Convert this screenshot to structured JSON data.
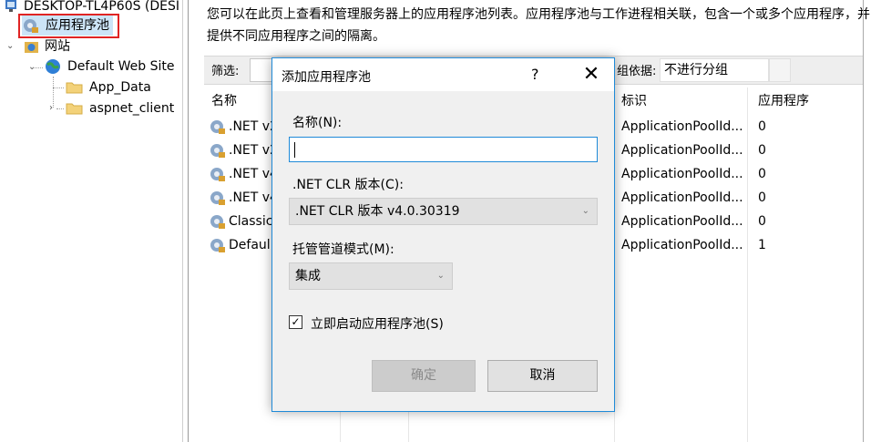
{
  "tree": {
    "server": "DESKTOP-TL4P60S (DESI",
    "app_pools": "应用程序池",
    "sites": "网站",
    "default_site": "Default Web Site",
    "app_data": "App_Data",
    "aspnet_client": "aspnet_client"
  },
  "main": {
    "description": "您可以在此页上查看和管理服务器上的应用程序池列表。应用程序池与工作进程相关联，包含一个或多个应用程序，并提供不同应用程序之间的隔离。",
    "filter_label": "筛选:",
    "group_label": "组依据:",
    "group_value": "不进行分组",
    "columns": [
      "名称",
      "标识",
      "应用程序"
    ],
    "rows": [
      {
        "name": ".NET v2",
        "identity": "ApplicationPoolId...",
        "apps": "0"
      },
      {
        "name": ".NET v2",
        "identity": "ApplicationPoolId...",
        "apps": "0"
      },
      {
        "name": ".NET v4",
        "identity": "ApplicationPoolId...",
        "apps": "0"
      },
      {
        "name": ".NET v4",
        "identity": "ApplicationPoolId...",
        "apps": "0"
      },
      {
        "name": "Classic",
        "identity": "ApplicationPoolId...",
        "apps": "0"
      },
      {
        "name": "Defaul",
        "identity": "ApplicationPoolId...",
        "apps": "1"
      }
    ]
  },
  "dialog": {
    "title": "添加应用程序池",
    "help": "?",
    "close": "✕",
    "name_label": "名称(N):",
    "name_value": "",
    "clr_label": ".NET CLR 版本(C):",
    "clr_value": ".NET CLR 版本 v4.0.30319",
    "pipeline_label": "托管管道模式(M):",
    "pipeline_value": "集成",
    "autostart_label": "立即启动应用程序池(S)",
    "autostart_checked": "✓",
    "ok_label": "确定",
    "cancel_label": "取消"
  },
  "colors": {
    "accent": "#1f8ad8",
    "highlight_border": "#e02424"
  }
}
